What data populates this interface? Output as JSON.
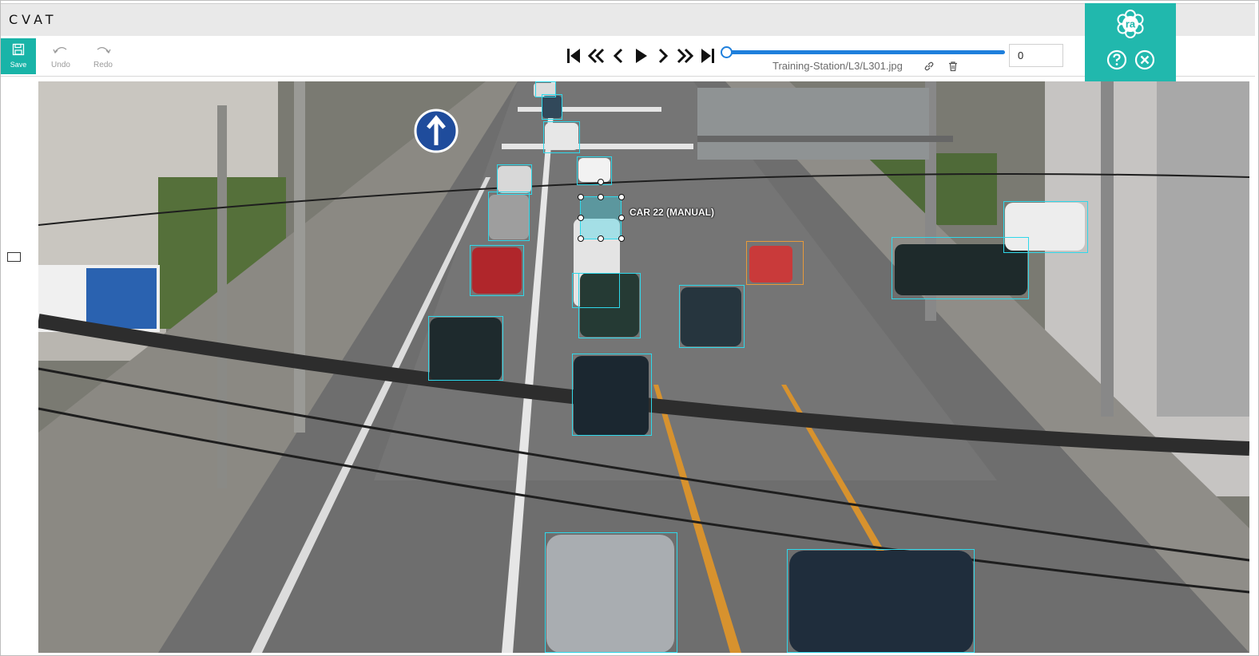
{
  "app": {
    "logo_text": "CVAT"
  },
  "toolbar": {
    "save_label": "Save",
    "undo_label": "Undo",
    "redo_label": "Redo"
  },
  "player": {
    "filename": "Training-Station/L3/L301.jpg",
    "frame_value": "0",
    "buttons": [
      "first-frame-icon",
      "backward-step-icon",
      "previous-frame-icon",
      "play-icon",
      "next-frame-icon",
      "forward-step-icon",
      "last-frame-icon"
    ],
    "progress_fraction": 0
  },
  "ra_panel": {
    "badge_text": "ra",
    "help_icon": "question-circle-icon",
    "close_icon": "close-circle-icon"
  },
  "annotations": {
    "active_label": "CAR 22 (MANUAL)"
  },
  "colors": {
    "accent": "#19b4a8",
    "ra_panel": "#21b8ad",
    "slider": "#1e7fdc",
    "bbox_car": "#2fd8ea",
    "bbox_motorcycle": "#e79a3a"
  }
}
